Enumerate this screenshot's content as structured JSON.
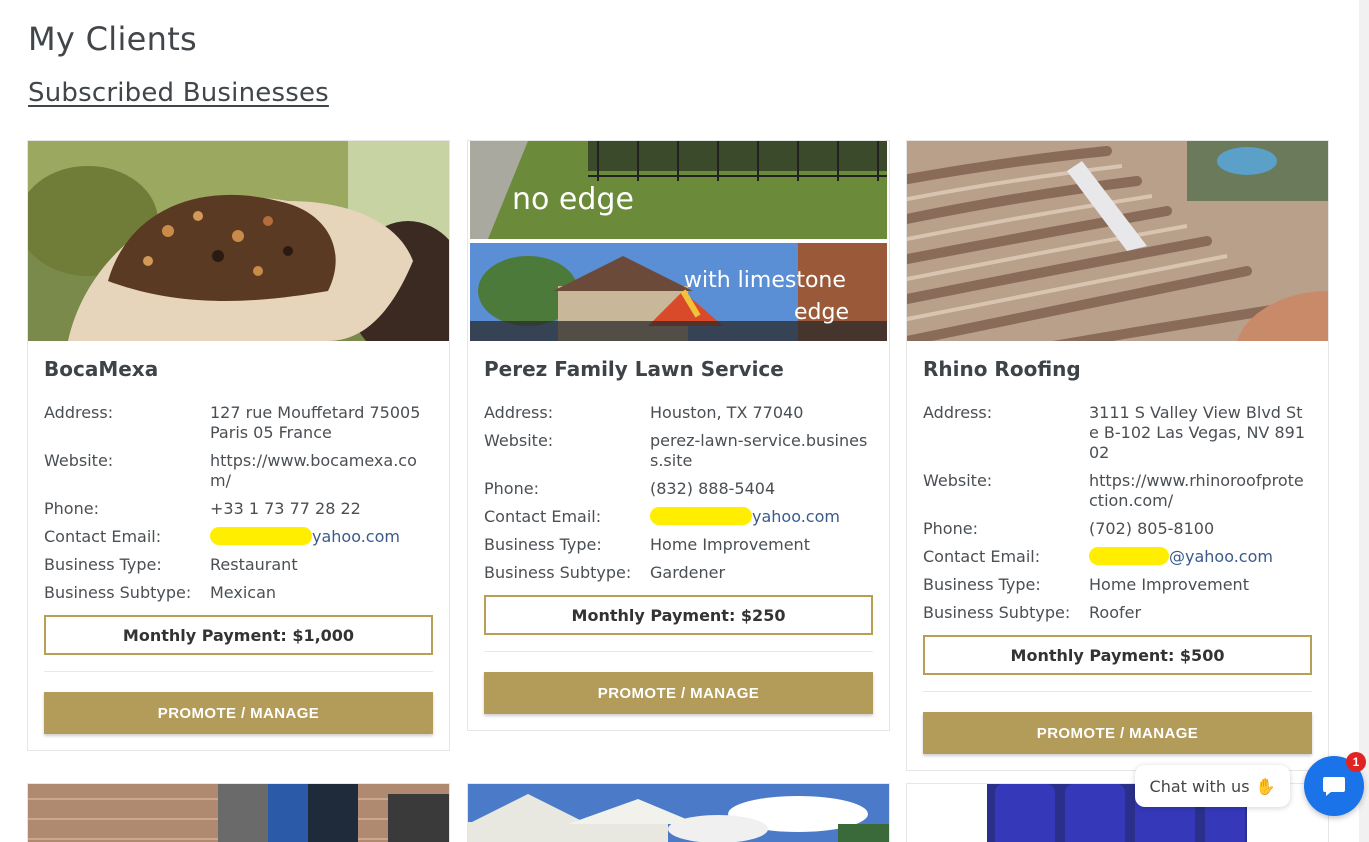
{
  "page": {
    "title": "My Clients",
    "section_title": "Subscribed Businesses"
  },
  "labels": {
    "address": "Address:",
    "website": "Website:",
    "phone": "Phone:",
    "contact_email": "Contact Email:",
    "business_type": "Business Type:",
    "business_subtype": "Business Subtype:"
  },
  "businesses": [
    {
      "name": "BocaMexa",
      "address": "127 rue Mouffetard 75005 Paris 05 France",
      "website": "https://www.bocamexa.com/",
      "phone": "+33 1 73 77 28 22",
      "email_domain": "yahoo.com",
      "business_type": "Restaurant",
      "business_subtype": "Mexican",
      "payment": "Monthly Payment: $1,000",
      "button": "PROMOTE / MANAGE"
    },
    {
      "name": "Perez Family Lawn Service",
      "image_caption_top": "no edge",
      "image_caption_bottom_1": "with limestone",
      "image_caption_bottom_2": "edge",
      "address": "Houston, TX 77040",
      "website": "perez-lawn-service.business.site",
      "phone": "(832) 888-5404",
      "email_domain": "yahoo.com",
      "business_type": "Home Improvement",
      "business_subtype": "Gardener",
      "payment": "Monthly Payment: $250",
      "button": "PROMOTE / MANAGE"
    },
    {
      "name": "Rhino Roofing",
      "address": "3111 S Valley View Blvd Ste B-102 Las Vegas, NV 89102",
      "website": "https://www.rhinoroofprotection.com/",
      "phone": "(702) 805-8100",
      "email_domain": "@yahoo.com",
      "business_type": "Home Improvement",
      "business_subtype": "Roofer",
      "payment": "Monthly Payment: $500",
      "button": "PROMOTE / MANAGE"
    }
  ],
  "chat": {
    "label": "Chat with us",
    "badge_count": "1"
  },
  "colors": {
    "accent": "#b39b59",
    "payment_border": "#b7a053",
    "chat_blue": "#1a73e8",
    "badge_red": "#e02424"
  }
}
